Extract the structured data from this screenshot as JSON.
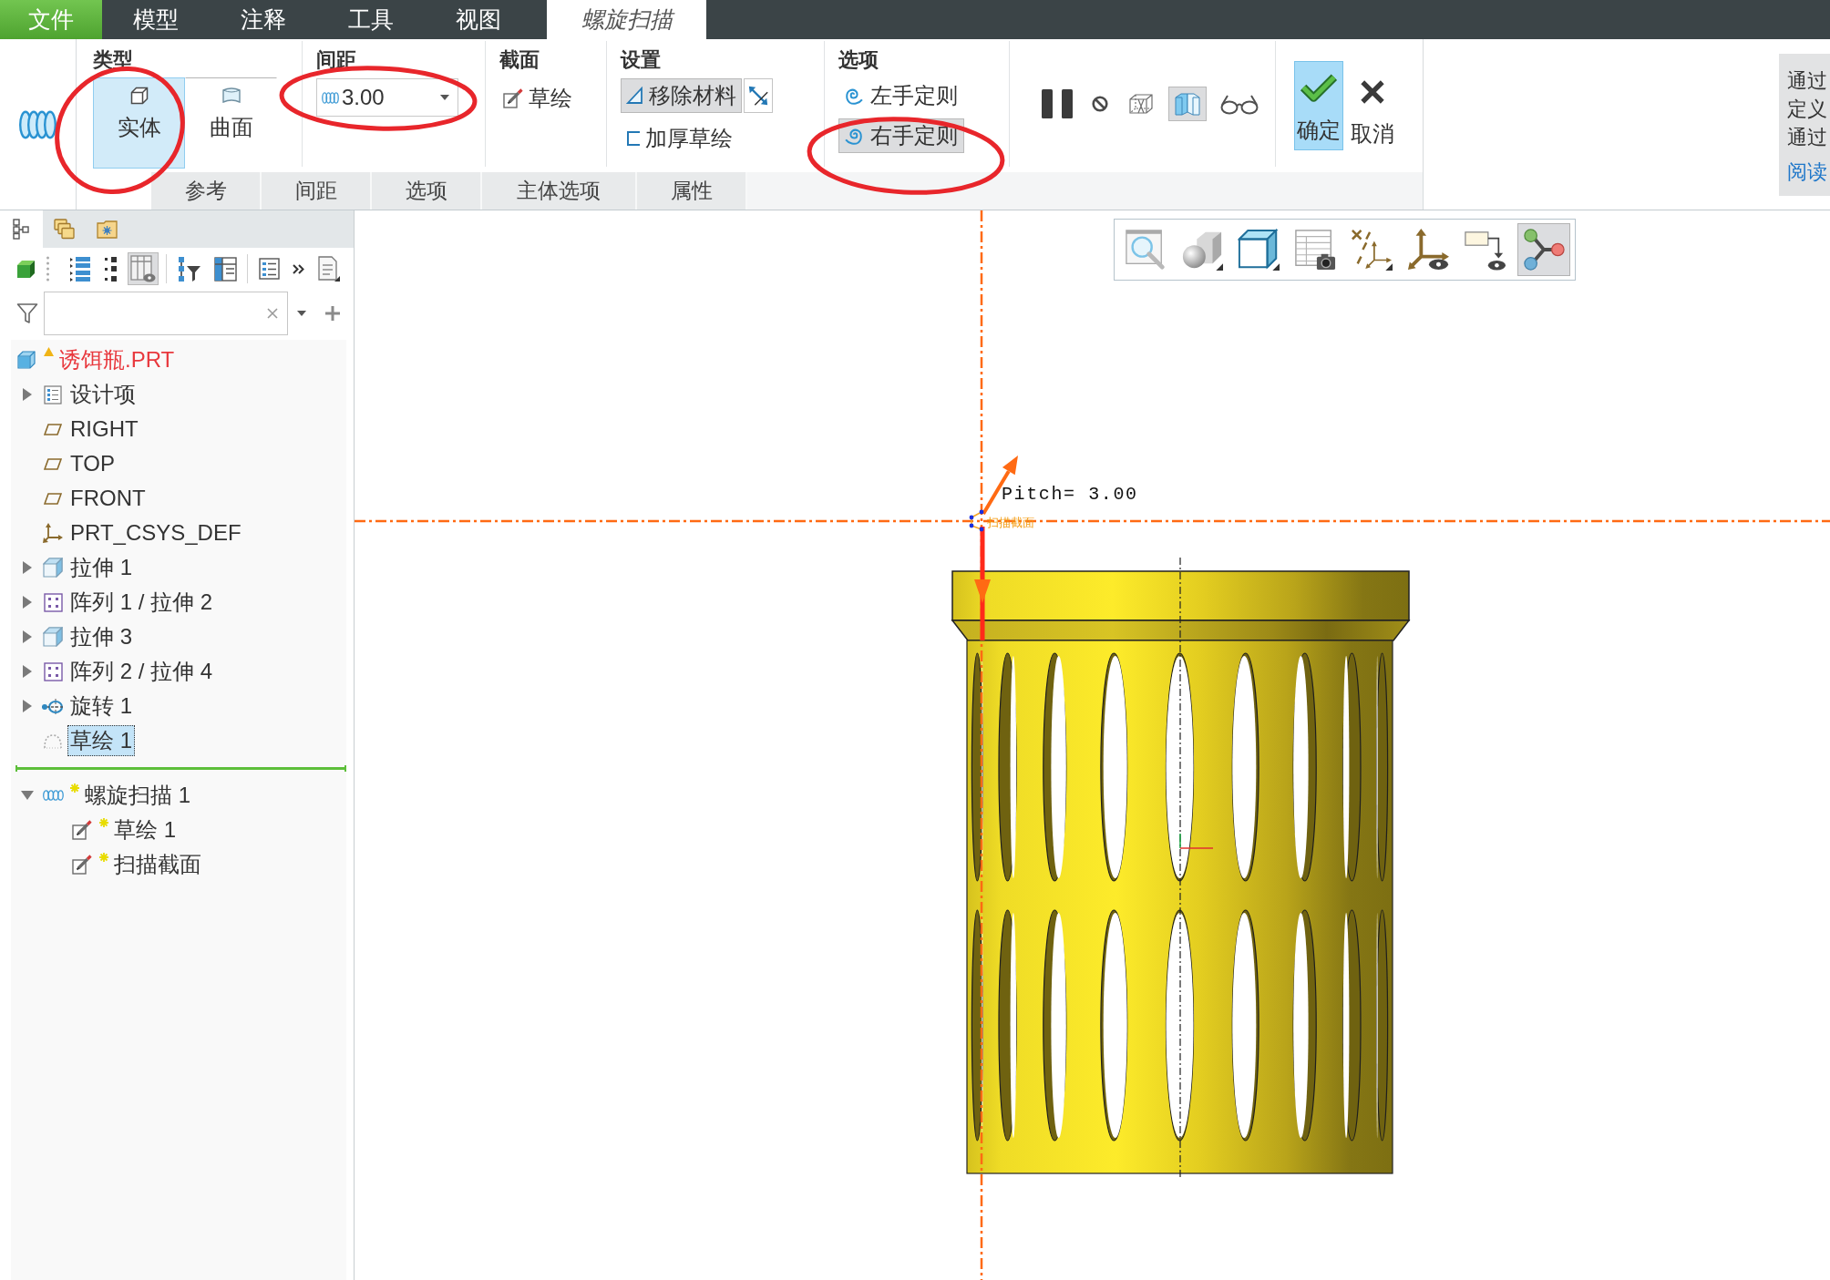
{
  "menu_bar": {
    "tabs": [
      {
        "label": "文件",
        "kind": "file",
        "selected": false
      },
      {
        "label": "模型",
        "kind": "tab",
        "selected": false
      },
      {
        "label": "注释",
        "kind": "tab",
        "selected": false
      },
      {
        "label": "工具",
        "kind": "tab",
        "selected": false
      },
      {
        "label": "视图",
        "kind": "tab",
        "selected": false
      },
      {
        "label": "螺旋扫描",
        "kind": "tab",
        "selected": true
      }
    ]
  },
  "ribbon": {
    "type_group": {
      "title": "类型",
      "options": [
        {
          "label": "实体",
          "selected": true,
          "circled": true
        },
        {
          "label": "曲面",
          "selected": false,
          "circled": false
        }
      ]
    },
    "pitch_group": {
      "title": "间距",
      "field": {
        "value": "3.00",
        "circled": true
      }
    },
    "section_group": {
      "title": "截面",
      "sketch_button": "草绘"
    },
    "settings_group": {
      "title": "设置",
      "toggles": [
        {
          "label": "移除材料",
          "pressed": true
        },
        {
          "label": "加厚草绘",
          "pressed": false
        }
      ]
    },
    "options_group": {
      "title": "选项",
      "options": [
        {
          "label": "左手定则",
          "selected": false,
          "circled": false
        },
        {
          "label": "右手定则",
          "selected": true,
          "circled": true
        }
      ]
    },
    "preview_tools": [
      {
        "pressed": false
      },
      {
        "pressed": false
      },
      {
        "pressed": false
      },
      {
        "pressed": true
      },
      {
        "pressed": false
      }
    ],
    "actions": [
      {
        "label": "确定",
        "kind": "ok"
      },
      {
        "label": "取消",
        "kind": "cancel"
      }
    ],
    "panel_tabs": [
      {
        "label": "参考",
        "selected": false
      },
      {
        "label": "间距",
        "selected": false
      },
      {
        "label": "选项",
        "selected": false
      },
      {
        "label": "主体选项",
        "selected": false
      },
      {
        "label": "属性",
        "selected": false
      }
    ]
  },
  "help_panel": {
    "lines": [
      "通过",
      "定义",
      "通过"
    ],
    "link": "阅读"
  },
  "navigator": {
    "tabs": [
      {
        "selected": true
      },
      {
        "selected": false
      },
      {
        "selected": false
      }
    ],
    "toolbar": [
      {
        "pressed": false
      },
      {
        "pressed": false
      },
      {
        "pressed": false
      },
      {
        "pressed": true
      },
      {
        "pressed": false
      },
      {
        "pressed": false
      },
      {
        "pressed": false
      },
      {
        "pressed": false
      },
      {
        "pressed": false
      }
    ],
    "tree": {
      "label": "诱饵瓶.PRT",
      "warning": true,
      "children": [
        {
          "label": "设计项",
          "kind": "design-items",
          "expandable": true,
          "expanded": false,
          "selected": false,
          "new": false
        },
        {
          "label": "RIGHT",
          "kind": "plane",
          "expandable": false,
          "expanded": false,
          "selected": false,
          "new": false
        },
        {
          "label": "TOP",
          "kind": "plane",
          "expandable": false,
          "expanded": false,
          "selected": false,
          "new": false
        },
        {
          "label": "FRONT",
          "kind": "plane",
          "expandable": false,
          "expanded": false,
          "selected": false,
          "new": false
        },
        {
          "label": "PRT_CSYS_DEF",
          "kind": "csys",
          "expandable": false,
          "expanded": false,
          "selected": false,
          "new": false
        },
        {
          "label": "拉伸 1",
          "kind": "extrude",
          "expandable": true,
          "expanded": false,
          "selected": false,
          "new": false
        },
        {
          "label": "阵列 1 / 拉伸 2",
          "kind": "pattern",
          "expandable": true,
          "expanded": false,
          "selected": false,
          "new": false
        },
        {
          "label": "拉伸 3",
          "kind": "extrude",
          "expandable": true,
          "expanded": false,
          "selected": false,
          "new": false
        },
        {
          "label": "阵列 2 / 拉伸 4",
          "kind": "pattern",
          "expandable": true,
          "expanded": false,
          "selected": false,
          "new": false
        },
        {
          "label": "旋转 1",
          "kind": "revolve",
          "expandable": true,
          "expanded": false,
          "selected": false,
          "new": false
        },
        {
          "label": "草绘 1",
          "kind": "sketch",
          "expandable": false,
          "expanded": false,
          "selected": true,
          "new": false
        },
        {
          "kind": "insert-marker"
        },
        {
          "label": "螺旋扫描 1",
          "kind": "helical-sweep",
          "expandable": true,
          "expanded": true,
          "selected": false,
          "new": true,
          "children": [
            {
              "label": "草绘 1",
              "kind": "sketch-edit",
              "expandable": false,
              "expanded": false,
              "selected": false,
              "new": true
            },
            {
              "label": "扫描截面",
              "kind": "sketch-edit",
              "expandable": false,
              "expanded": false,
              "selected": false,
              "new": true
            }
          ]
        }
      ]
    }
  },
  "graphics": {
    "view_toolbar": [
      {
        "pressed": false
      },
      {
        "pressed": false
      },
      {
        "pressed": false
      },
      {
        "pressed": false
      },
      {
        "pressed": false
      },
      {
        "pressed": false
      },
      {
        "pressed": false
      },
      {
        "pressed": true
      }
    ],
    "pitch_label": "Pitch= 3.00",
    "section_label": "扫描截面"
  }
}
